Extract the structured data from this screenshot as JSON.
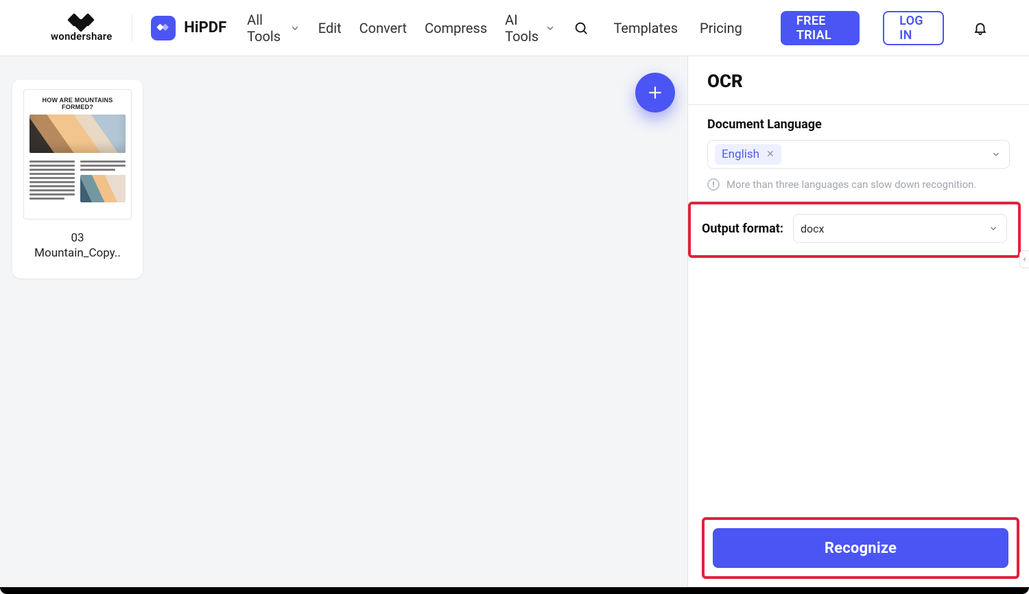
{
  "brand": {
    "parent": "wondershare",
    "product": "HiPDF"
  },
  "nav": {
    "all_tools": "All Tools",
    "edit": "Edit",
    "convert": "Convert",
    "compress": "Compress",
    "ai_tools": "AI Tools",
    "templates": "Templates",
    "pricing": "Pricing"
  },
  "actions": {
    "free_trial": "FREE TRIAL",
    "log_in": "LOG IN"
  },
  "file": {
    "doc_title": "HOW ARE MOUNTAINS FORMED?",
    "name_line1": "03",
    "name_line2": "Mountain_Copy.."
  },
  "panel": {
    "title": "OCR",
    "lang_label": "Document Language",
    "lang_selected": "English",
    "lang_hint": "More than three languages can slow down recognition.",
    "output_label": "Output format:",
    "output_selected": "docx",
    "cta": "Recognize"
  }
}
